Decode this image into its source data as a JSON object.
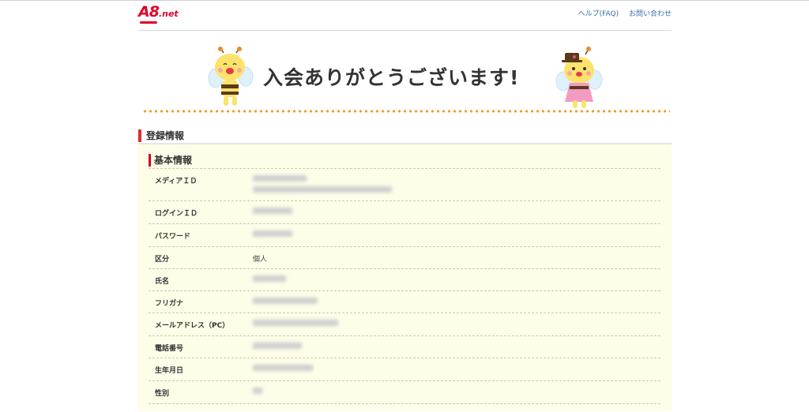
{
  "header": {
    "logo_main": "A8",
    "logo_suffix": ".net",
    "links": [
      "ヘルプ(FAQ)",
      "お問い合わせ"
    ]
  },
  "banner": {
    "title": "入会ありがとうございます!"
  },
  "section": {
    "title": "登録情報"
  },
  "basic_info": {
    "title": "基本情報",
    "rows": [
      {
        "label": "メディアＩＤ",
        "value": ""
      },
      {
        "label": "ログインＩＤ",
        "value": ""
      },
      {
        "label": "パスワード",
        "value": ""
      },
      {
        "label": "区分",
        "value": "個人"
      },
      {
        "label": "氏名",
        "value": ""
      },
      {
        "label": "フリガナ",
        "value": ""
      },
      {
        "label": "メールアドレス（PC）",
        "value": ""
      },
      {
        "label": "電話番号",
        "value": ""
      },
      {
        "label": "生年月日",
        "value": ""
      },
      {
        "label": "性別",
        "value": ""
      }
    ]
  },
  "colors": {
    "accent_red": "#e02d2d",
    "dots_orange": "#f39a2e",
    "panel_bg": "#fdfde8",
    "link_blue": "#3a6ea5"
  }
}
